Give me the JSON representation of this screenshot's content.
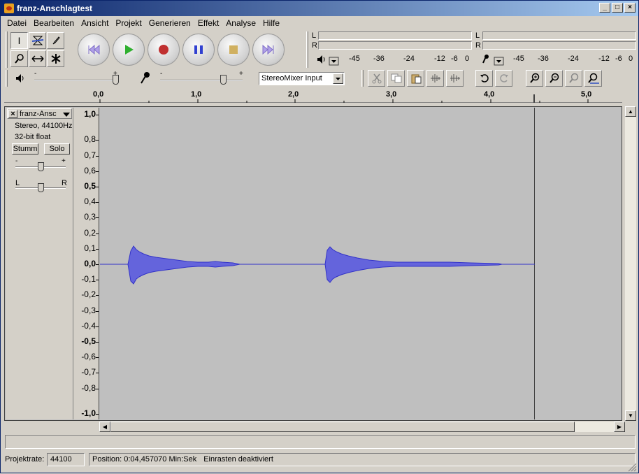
{
  "window": {
    "title": "franz-Anschlagtest",
    "min": "_",
    "max": "□",
    "close": "×"
  },
  "menu": [
    "Datei",
    "Bearbeiten",
    "Ansicht",
    "Projekt",
    "Generieren",
    "Effekt",
    "Analyse",
    "Hilfe"
  ],
  "meter": {
    "left": "L",
    "right": "R",
    "scale": [
      "-45",
      "-36",
      "-24",
      "-12",
      "-6",
      "0"
    ]
  },
  "mixer": {
    "output_min": "-",
    "output_max": "+",
    "input_min": "-",
    "input_max": "+",
    "input_source": "StereoMixer Input"
  },
  "ruler": {
    "ticks": [
      "0,0",
      "1,0",
      "2,0",
      "3,0",
      "4,0",
      "5,0"
    ]
  },
  "track": {
    "name": "franz-Ansc",
    "info1": "Stereo, 44100Hz",
    "info2": "32-bit float",
    "mute": "Stumm",
    "solo": "Solo",
    "gain_min": "-",
    "gain_max": "+",
    "pan_left": "L",
    "pan_right": "R"
  },
  "yaxis": [
    "1,0",
    "0,8",
    "0,7",
    "0,6",
    "0,5",
    "0,4",
    "0,3",
    "0,2",
    "0,1",
    "0,0",
    "-0,1",
    "-0,2",
    "-0,3",
    "-0,4",
    "-0,5",
    "-0,6",
    "-0,7",
    "-0,8",
    "-1,0"
  ],
  "status": {
    "rate_label": "Projektrate:",
    "rate_value": "44100",
    "position": "Position: 0:04,457070 Min:Sek",
    "snap": "Einrasten deaktiviert"
  },
  "colors": {
    "wave": "#3232c8",
    "wave_fill": "#6464dc",
    "selection_bg": "#bfbfbf"
  }
}
